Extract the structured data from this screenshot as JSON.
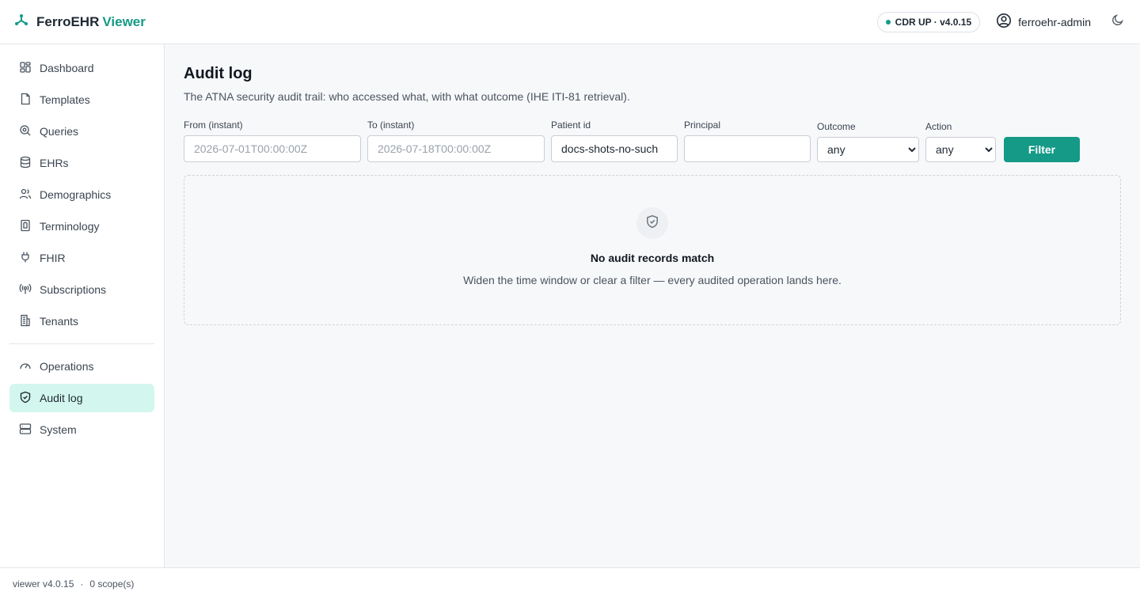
{
  "brand": {
    "name": "FerroEHR",
    "accent_word": "Viewer",
    "accent_color": "#149a87",
    "icon": "ferroehr-logo-icon"
  },
  "header": {
    "status": "CDR UP · v4.0.15",
    "username": "ferroehr-admin",
    "user_icon": "user-circle-icon",
    "theme_icon": "moon-icon"
  },
  "sidebar": {
    "items": [
      {
        "label": "Dashboard",
        "icon": "dashboard-icon"
      },
      {
        "label": "Templates",
        "icon": "file-icon"
      },
      {
        "label": "Queries",
        "icon": "search-icon"
      },
      {
        "label": "EHRs",
        "icon": "database-icon"
      },
      {
        "label": "Demographics",
        "icon": "users-icon"
      },
      {
        "label": "Terminology",
        "icon": "book-icon"
      },
      {
        "label": "FHIR",
        "icon": "plug-icon"
      },
      {
        "label": "Subscriptions",
        "icon": "broadcast-icon"
      },
      {
        "label": "Tenants",
        "icon": "building-icon"
      }
    ],
    "secondary_items": [
      {
        "label": "Operations",
        "icon": "gauge-icon"
      },
      {
        "label": "Audit log",
        "icon": "shield-icon",
        "active": true
      },
      {
        "label": "System",
        "icon": "server-icon"
      }
    ]
  },
  "main": {
    "title": "Audit log",
    "subtitle": "The ATNA security audit trail: who accessed what, with what outcome (IHE ITI-81 retrieval).",
    "filters": {
      "from": {
        "label": "From (instant)",
        "placeholder": "2026-07-01T00:00:00Z",
        "value": ""
      },
      "to": {
        "label": "To (instant)",
        "placeholder": "2026-07-18T00:00:00Z",
        "value": ""
      },
      "patient": {
        "label": "Patient id",
        "value": "docs-shots-no-such"
      },
      "principal": {
        "label": "Principal",
        "value": ""
      },
      "outcome": {
        "label": "Outcome",
        "value": "any"
      },
      "action": {
        "label": "Action",
        "value": "any"
      },
      "button": "Filter"
    },
    "empty": {
      "title": "No audit records match",
      "message": "Widen the time window or clear a filter — every audited operation lands here."
    }
  },
  "footer": {
    "version": "viewer v4.0.15",
    "separator": "·",
    "scopes": "0 scope(s)"
  }
}
